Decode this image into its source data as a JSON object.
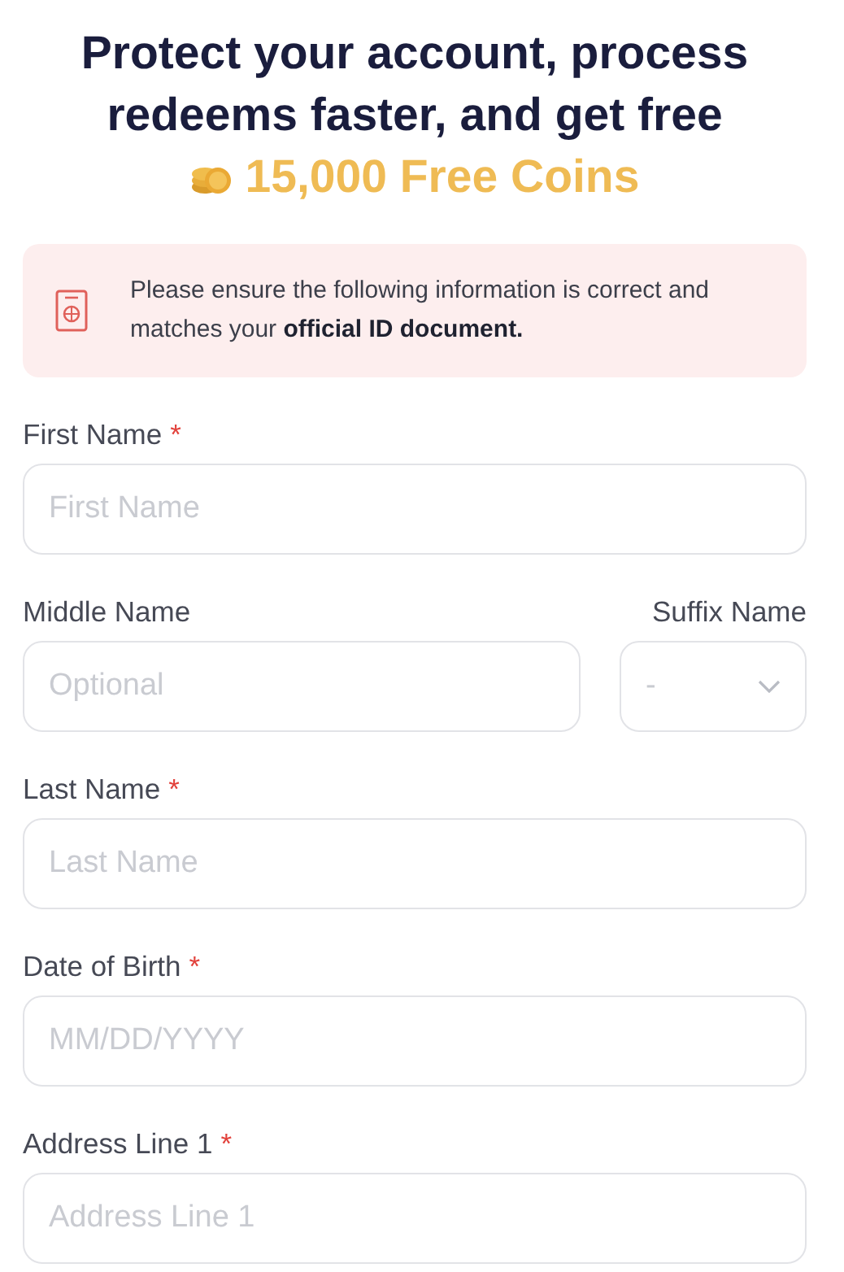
{
  "heading": {
    "lines": [
      "Protect your account, process",
      "redeems faster, and get free"
    ],
    "reward": "15,000 Free Coins"
  },
  "notice": {
    "text": "Please ensure the following information is correct and matches your **official ID document.**"
  },
  "form": {
    "rows": [
      {
        "fields": [
          {
            "kind": "text",
            "label": "First Name",
            "required_marker": "*",
            "placeholder": "First Name"
          }
        ]
      },
      {
        "fields": [
          {
            "kind": "text",
            "label": "Middle Name",
            "placeholder": "Optional"
          },
          {
            "kind": "select",
            "label": "Suffix Name",
            "value": "-"
          }
        ]
      },
      {
        "fields": [
          {
            "kind": "text",
            "label": "Last Name",
            "required_marker": "*",
            "placeholder": "Last Name"
          }
        ]
      },
      {
        "fields": [
          {
            "kind": "text",
            "label": "Date of Birth",
            "required_marker": "*",
            "placeholder": "MM/DD/YYYY"
          }
        ]
      },
      {
        "fields": [
          {
            "kind": "text",
            "label": "Address Line 1",
            "required_marker": "*",
            "placeholder": "Address Line 1"
          }
        ]
      }
    ]
  }
}
